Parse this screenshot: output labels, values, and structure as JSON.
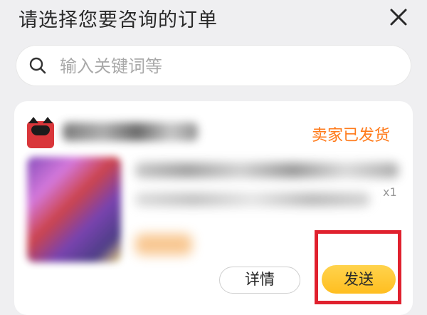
{
  "header": {
    "title": "请选择您要咨询的订单"
  },
  "search": {
    "placeholder": "输入关键词等",
    "value": ""
  },
  "order": {
    "status": "卖家已发货",
    "qty_suffix": "x1",
    "detail_label": "详情",
    "send_label": "发送"
  },
  "colors": {
    "status": "#ff7a1a",
    "send_button": "#ffc72a",
    "highlight": "#e0212e"
  }
}
